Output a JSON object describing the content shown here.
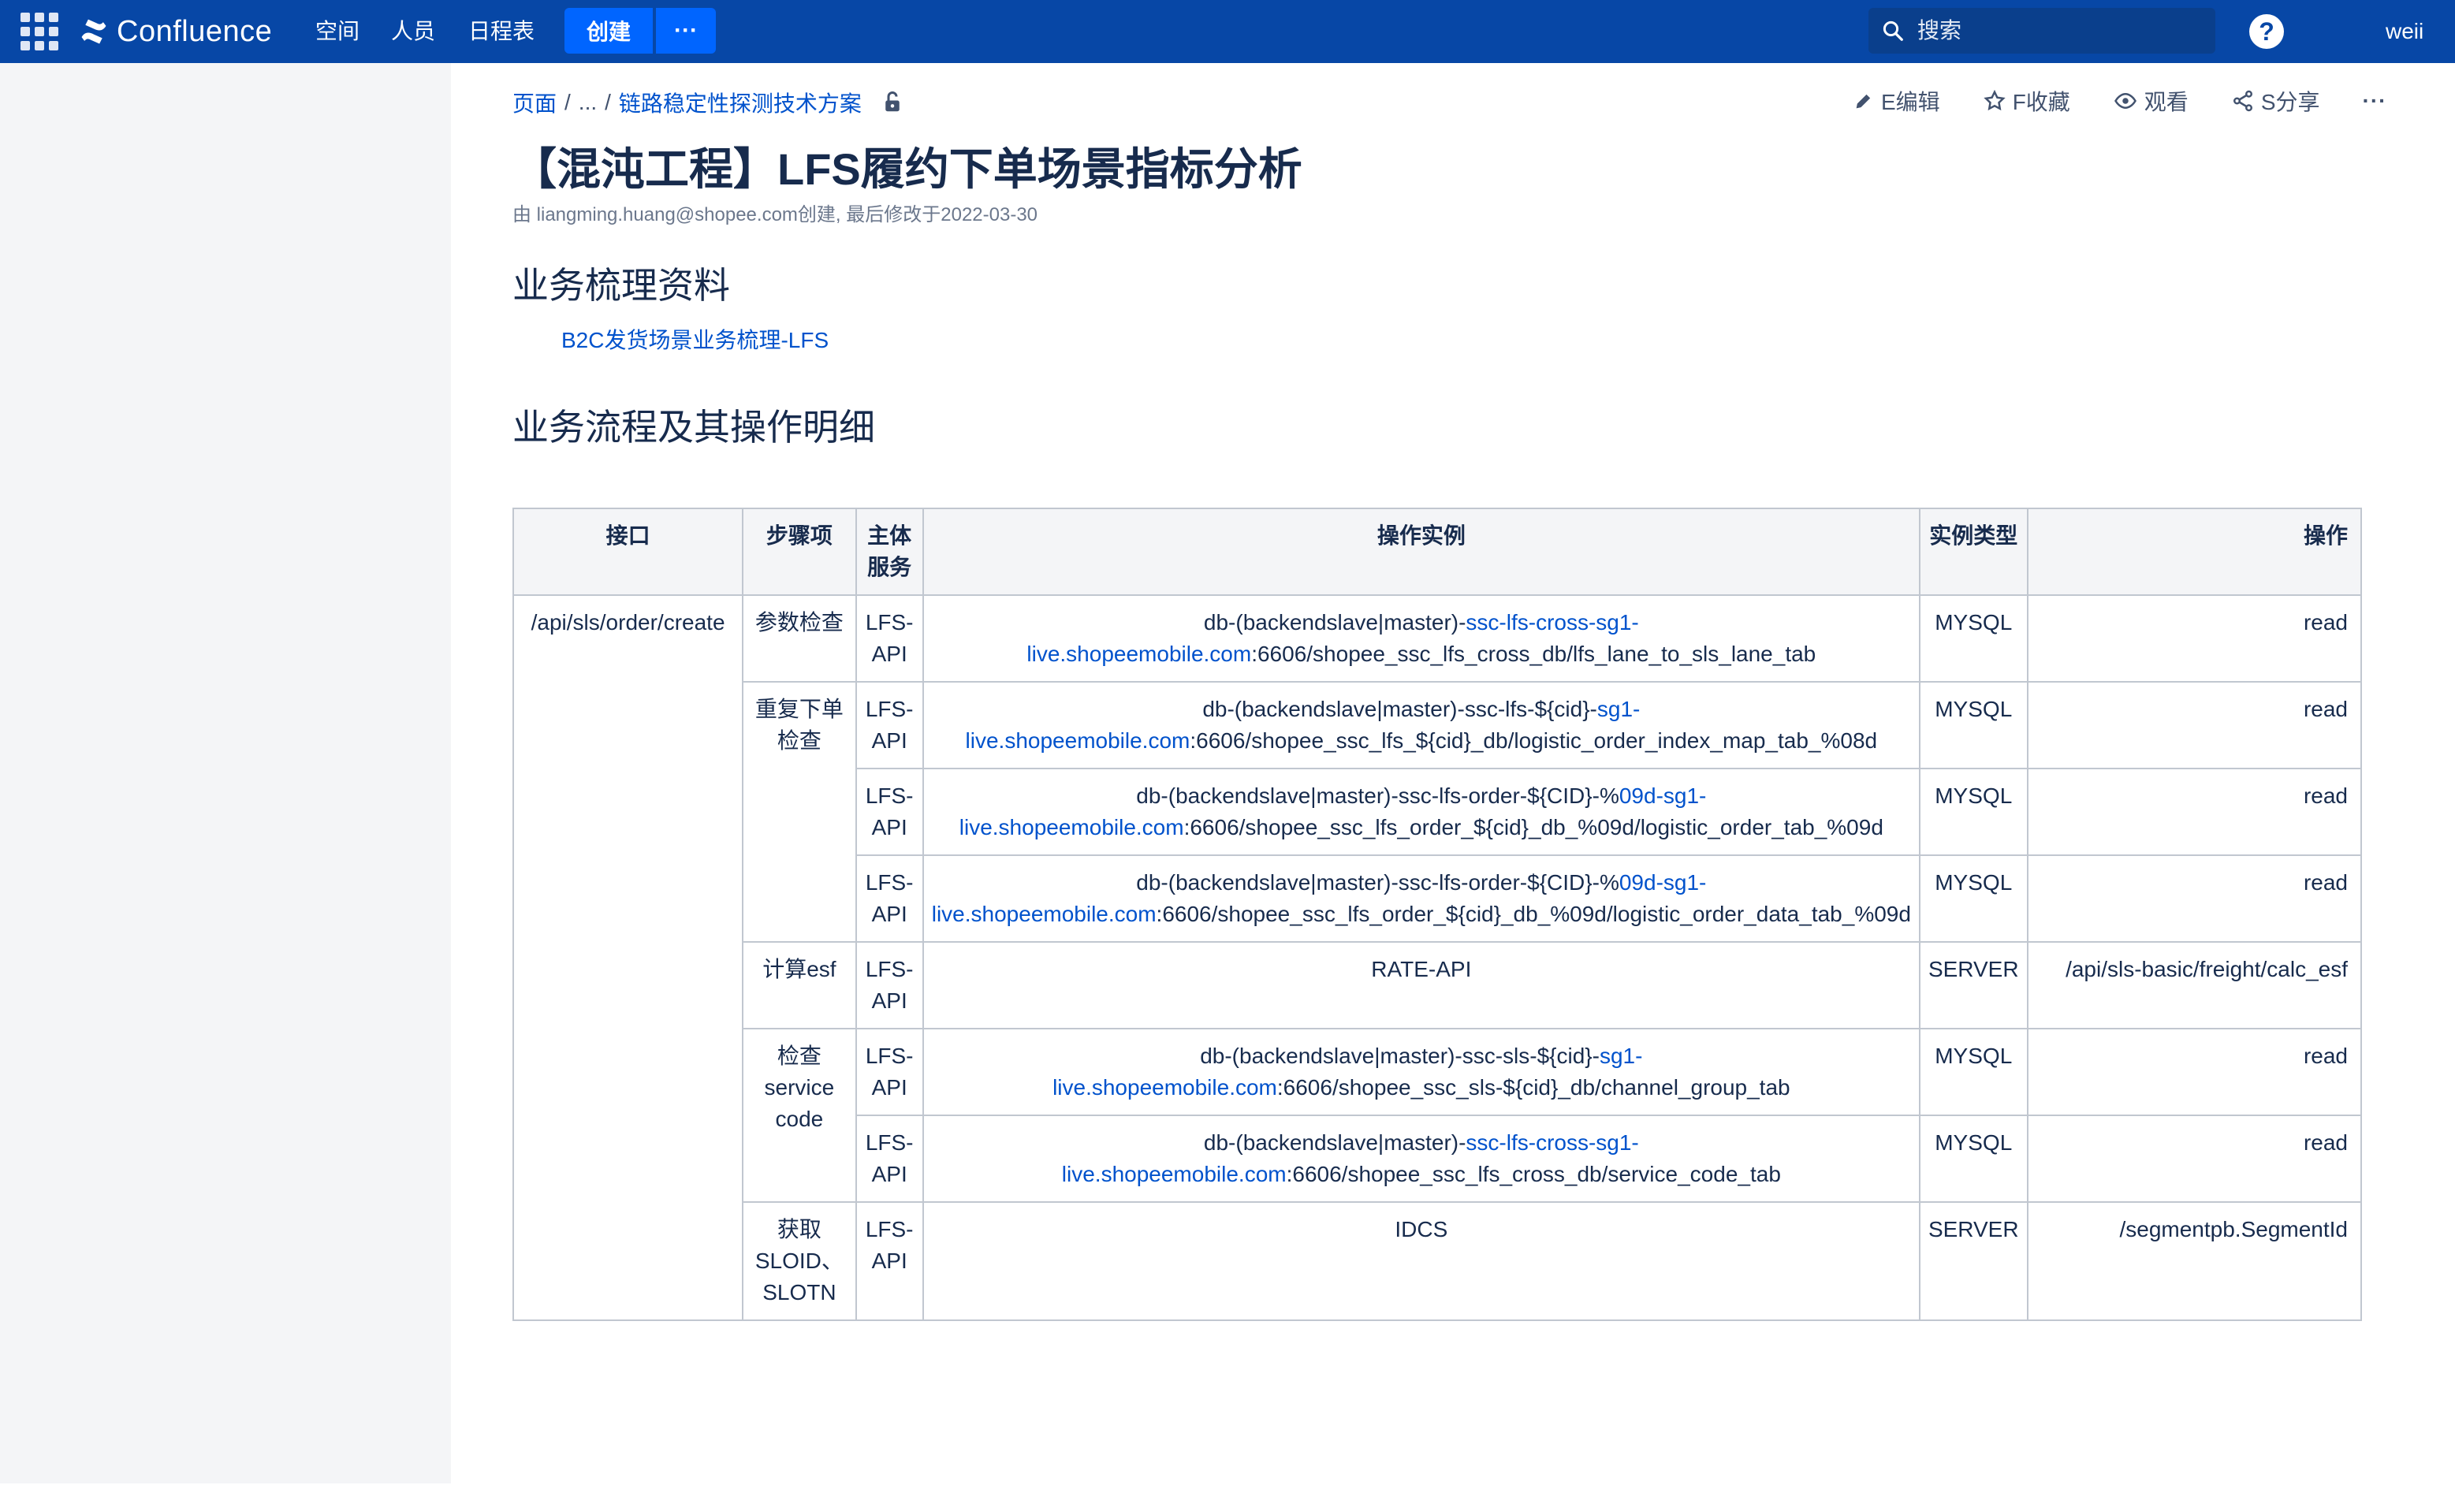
{
  "topnav": {
    "product": "Confluence",
    "items": [
      "空间",
      "人员",
      "日程表"
    ],
    "create_label": "创建",
    "more_label": "···",
    "search_placeholder": "搜索",
    "user": "weii"
  },
  "breadcrumb": {
    "root": "页面",
    "ellipsis": "...",
    "parent": "链路稳定性探测技术方案"
  },
  "actions": {
    "edit": "E编辑",
    "favorite": "F收藏",
    "watch": "观看",
    "share": "S分享",
    "more": "···"
  },
  "page": {
    "title": "【混沌工程】LFS履约下单场景指标分析",
    "byline": "由 liangming.huang@shopee.com创建, 最后修改于2022-03-30",
    "section1": "业务梳理资料",
    "section1_link": "B2C发货场景业务梳理-LFS",
    "section2": "业务流程及其操作明细"
  },
  "table": {
    "headers": [
      "接口",
      "步骤项",
      "主体服务",
      "操作实例",
      "实例类型",
      "操作"
    ],
    "interface": "/api/sls/order/create",
    "rows": [
      {
        "step": "参数检查",
        "svc": "LFS-API",
        "ex_pre": "db-(backendslave|master)-",
        "ex_link": "ssc-lfs-cross-sg1-live.shopeemobile.com",
        "ex_post": ":6606/shopee_ssc_lfs_cross_db/lfs_lane_to_sls_lane_tab",
        "type": "MYSQL",
        "op": "read"
      },
      {
        "step": "重复下单检查",
        "svc": "LFS-API",
        "ex_pre": "db-(backendslave|master)-ssc-lfs-${cid}-",
        "ex_link": "sg1-live.shopeemobile.com",
        "ex_post": ":6606/shopee_ssc_lfs_${cid}_db/logistic_order_index_map_tab_%08d",
        "type": "MYSQL",
        "op": "read"
      },
      {
        "step": "",
        "svc": "LFS-API",
        "ex_pre": "db-(backendslave|master)-ssc-lfs-order-${CID}-%",
        "ex_link": "09d-sg1-live.shopeemobile.com",
        "ex_post": ":6606/shopee_ssc_lfs_order_${cid}_db_%09d/logistic_order_tab_%09d",
        "type": "MYSQL",
        "op": "read"
      },
      {
        "step": "",
        "svc": "LFS-API",
        "ex_pre": "db-(backendslave|master)-ssc-lfs-order-${CID}-%",
        "ex_link": "09d-sg1-live.shopeemobile.com",
        "ex_post": ":6606/shopee_ssc_lfs_order_${cid}_db_%09d/logistic_order_data_tab_%09d",
        "type": "MYSQL",
        "op": "read"
      },
      {
        "step": "计算esf",
        "svc": "LFS-API",
        "ex_pre": "RATE-API",
        "ex_link": "",
        "ex_post": "",
        "type": "SERVER",
        "op": "/api/sls-basic/freight/calc_esf"
      },
      {
        "step": "检查service code",
        "svc": "LFS-API",
        "ex_pre": "db-(backendslave|master)-ssc-sls-${cid}-",
        "ex_link": "sg1-live.shopeemobile.com",
        "ex_post": ":6606/shopee_ssc_sls-${cid}_db/channel_group_tab",
        "type": "MYSQL",
        "op": "read"
      },
      {
        "step": "",
        "svc": "LFS-API",
        "ex_pre": "db-(backendslave|master)-",
        "ex_link": "ssc-lfs-cross-sg1-live.shopeemobile.com",
        "ex_post": ":6606/shopee_ssc_lfs_cross_db/service_code_tab",
        "type": "MYSQL",
        "op": "read"
      },
      {
        "step": "获取SLOID、SLOTN",
        "svc": "LFS-API",
        "ex_pre": "IDCS",
        "ex_link": "",
        "ex_post": "",
        "type": "SERVER",
        "op": "/segmentpb.SegmentId"
      }
    ]
  }
}
